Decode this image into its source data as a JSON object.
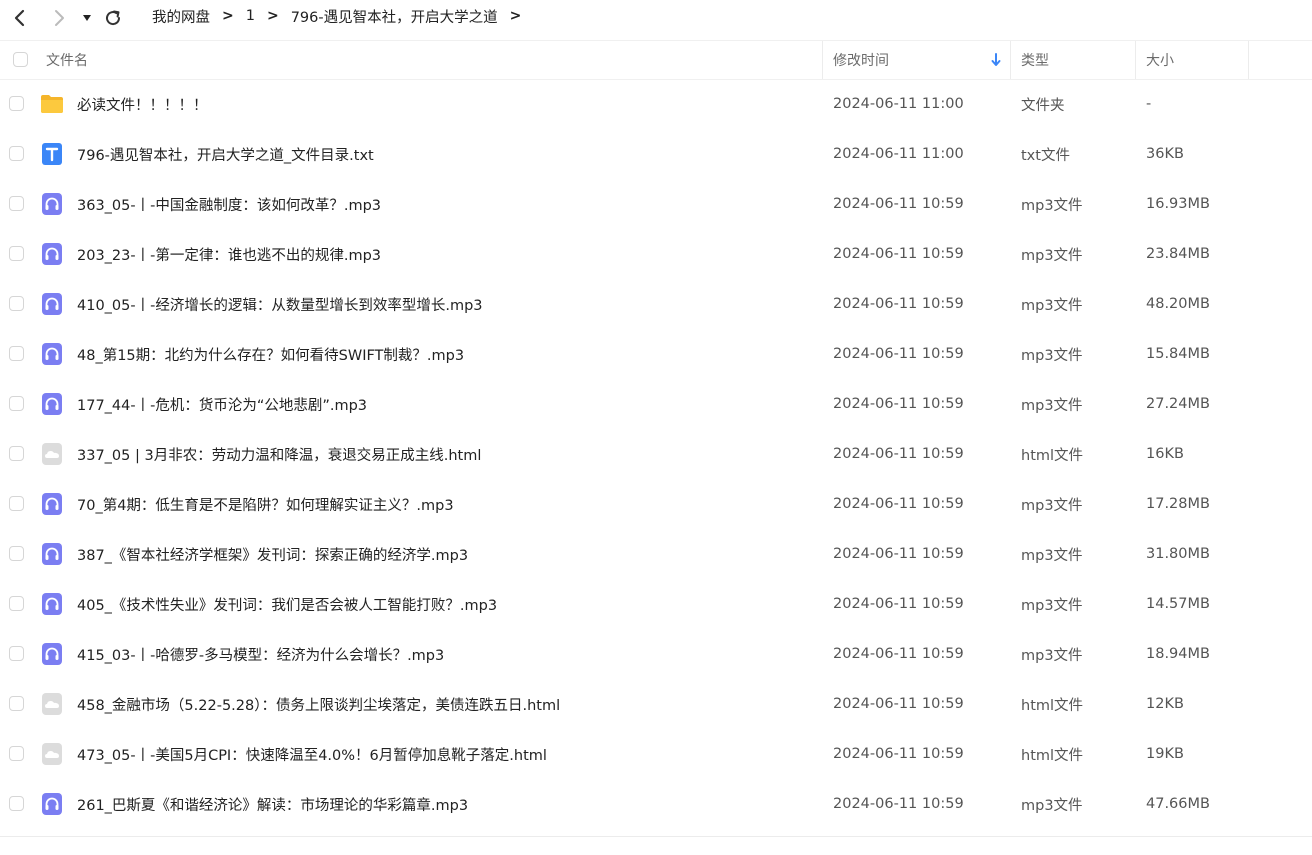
{
  "breadcrumb": [
    "我的网盘",
    "1",
    "796-遇见智本社，开启大学之道"
  ],
  "columns": {
    "name": "文件名",
    "modified": "修改时间",
    "type": "类型",
    "size": "大小"
  },
  "files": [
    {
      "icon": "folder-icon",
      "name": "必读文件！！！！！",
      "modified": "2024-06-11 11:00",
      "type": "文件夹",
      "size": "-"
    },
    {
      "icon": "txt-file-icon",
      "name": "796-遇见智本社，开启大学之道_文件目录.txt",
      "modified": "2024-06-11 11:00",
      "type": "txt文件",
      "size": "36KB"
    },
    {
      "icon": "audio-file-icon",
      "name": "363_05-丨-中国金融制度：该如何改革？.mp3",
      "modified": "2024-06-11 10:59",
      "type": "mp3文件",
      "size": "16.93MB"
    },
    {
      "icon": "audio-file-icon",
      "name": "203_23-丨-第一定律：谁也逃不出的规律.mp3",
      "modified": "2024-06-11 10:59",
      "type": "mp3文件",
      "size": "23.84MB"
    },
    {
      "icon": "audio-file-icon",
      "name": "410_05-丨-经济增长的逻辑：从数量型增长到效率型增长.mp3",
      "modified": "2024-06-11 10:59",
      "type": "mp3文件",
      "size": "48.20MB"
    },
    {
      "icon": "audio-file-icon",
      "name": "48_第15期：北约为什么存在？如何看待SWIFT制裁？.mp3",
      "modified": "2024-06-11 10:59",
      "type": "mp3文件",
      "size": "15.84MB"
    },
    {
      "icon": "audio-file-icon",
      "name": "177_44-丨-危机：货币沦为“公地悲剧”.mp3",
      "modified": "2024-06-11 10:59",
      "type": "mp3文件",
      "size": "27.24MB"
    },
    {
      "icon": "html-file-icon",
      "name": "337_05 | 3月非农：劳动力温和降温，衰退交易正成主线.html",
      "modified": "2024-06-11 10:59",
      "type": "html文件",
      "size": "16KB"
    },
    {
      "icon": "audio-file-icon",
      "name": "70_第4期：低生育是不是陷阱？如何理解实证主义？.mp3",
      "modified": "2024-06-11 10:59",
      "type": "mp3文件",
      "size": "17.28MB"
    },
    {
      "icon": "audio-file-icon",
      "name": "387_《智本社经济学框架》发刊词：探索正确的经济学.mp3",
      "modified": "2024-06-11 10:59",
      "type": "mp3文件",
      "size": "31.80MB"
    },
    {
      "icon": "audio-file-icon",
      "name": "405_《技术性失业》发刊词：我们是否会被人工智能打败？.mp3",
      "modified": "2024-06-11 10:59",
      "type": "mp3文件",
      "size": "14.57MB"
    },
    {
      "icon": "audio-file-icon",
      "name": "415_03-丨-哈德罗-多马模型：经济为什么会增长？.mp3",
      "modified": "2024-06-11 10:59",
      "type": "mp3文件",
      "size": "18.94MB"
    },
    {
      "icon": "html-file-icon",
      "name": "458_金融市场（5.22-5.28）：债务上限谈判尘埃落定，美债连跌五日.html",
      "modified": "2024-06-11 10:59",
      "type": "html文件",
      "size": "12KB"
    },
    {
      "icon": "html-file-icon",
      "name": "473_05-丨-美国5月CPI：快速降温至4.0%！6月暂停加息靴子落定.html",
      "modified": "2024-06-11 10:59",
      "type": "html文件",
      "size": "19KB"
    },
    {
      "icon": "audio-file-icon",
      "name": "261_巴斯夏《和谐经济论》解读：市场理论的华彩篇章.mp3",
      "modified": "2024-06-11 10:59",
      "type": "mp3文件",
      "size": "47.66MB"
    }
  ],
  "colors": {
    "accent": "#3b86f7",
    "audio": "#7b7ef2",
    "folder": "#f9c23c",
    "html": "#d8d8d8"
  }
}
